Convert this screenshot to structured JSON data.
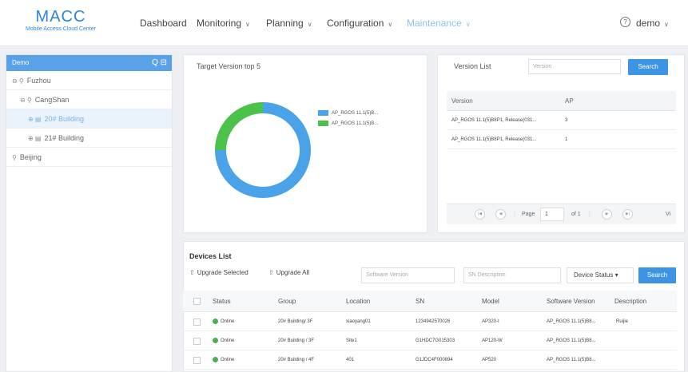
{
  "brand": {
    "title": "MACC",
    "subtitle": "Mobile Access Cloud Center"
  },
  "nav": {
    "dashboard": "Dashboard",
    "monitoring": "Monitoring",
    "planning": "Planning",
    "configuration": "Configuration",
    "maintenance": "Maintenance",
    "chevron": "∨",
    "help": "?",
    "user": "demo"
  },
  "sidebar": {
    "header": "Demo",
    "header_icons": "Q ⊟",
    "items": [
      {
        "icon": "⊖ ⚲",
        "label": "Fuzhou"
      },
      {
        "icon": "⊖ ⚲",
        "label": "CangShan"
      },
      {
        "icon": "⊕ ▤",
        "label": "20# Building"
      },
      {
        "icon": "⊕ ▤",
        "label": "21# Building"
      },
      {
        "icon": "⚲",
        "label": "Beijing"
      }
    ]
  },
  "target_panel": {
    "title": "Target Version top 5",
    "legend": [
      "AP_RGOS 11.1(5)B...",
      "AP_RGOS 11.1(5)B..."
    ]
  },
  "chart_data": {
    "type": "pie",
    "style": "donut",
    "categories": [
      "AP_RGOS 11.1(5)B...",
      "AP_RGOS 11.1(5)B..."
    ],
    "values": [
      3,
      1
    ],
    "colors": [
      "#4aa3e8",
      "#4cc24a"
    ],
    "legend_position": "right"
  },
  "version_list": {
    "title": "Version List",
    "search_placeholder": "Version",
    "search_button": "Search",
    "columns": [
      "Version",
      "AP"
    ],
    "rows": [
      {
        "version": "AP_RGOS 11.1(5)B8P1, Release(031...",
        "ap": "3"
      },
      {
        "version": "AP_RGOS 11.1(5)B8P1, Release(031...",
        "ap": "1"
      }
    ],
    "pager": {
      "first": "|◀",
      "prev": "◀",
      "page_label": "Page",
      "page_value": "1",
      "of_label": "of 1",
      "next": "▶",
      "last": "▶|",
      "trailing": "Vi"
    }
  },
  "devices": {
    "title": "Devices List",
    "upgrade_selected": "Upgrade Selected",
    "upgrade_all": "Upgrade All",
    "software_placeholder": "Software Version",
    "sn_placeholder": "SN Description",
    "status_select": "Device Status",
    "status_caret": "▾",
    "search_button": "Search",
    "columns": [
      "Status",
      "Group",
      "Location",
      "SN",
      "Model",
      "Software Version",
      "Description"
    ],
    "rows": [
      {
        "status": "Online",
        "group": "20# Building/ 3F",
        "location": "xiaoyang01",
        "sn": "1234942570026",
        "model": "AP320-I",
        "software": "AP_RGOS 11.1(5)B8...",
        "description": "Ruijie"
      },
      {
        "status": "Online",
        "group": "20# Building / 3F",
        "location": "Site1",
        "sn": "G1HDC7G015303",
        "model": "AP120-W",
        "software": "AP_RGOS 11.1(5)B8...",
        "description": ""
      },
      {
        "status": "Online",
        "group": "20# Building / 4F",
        "location": "401",
        "sn": "G1JDC4F000894",
        "model": "AP520",
        "software": "AP_RGOS 11.1(5)B8...",
        "description": ""
      }
    ]
  }
}
